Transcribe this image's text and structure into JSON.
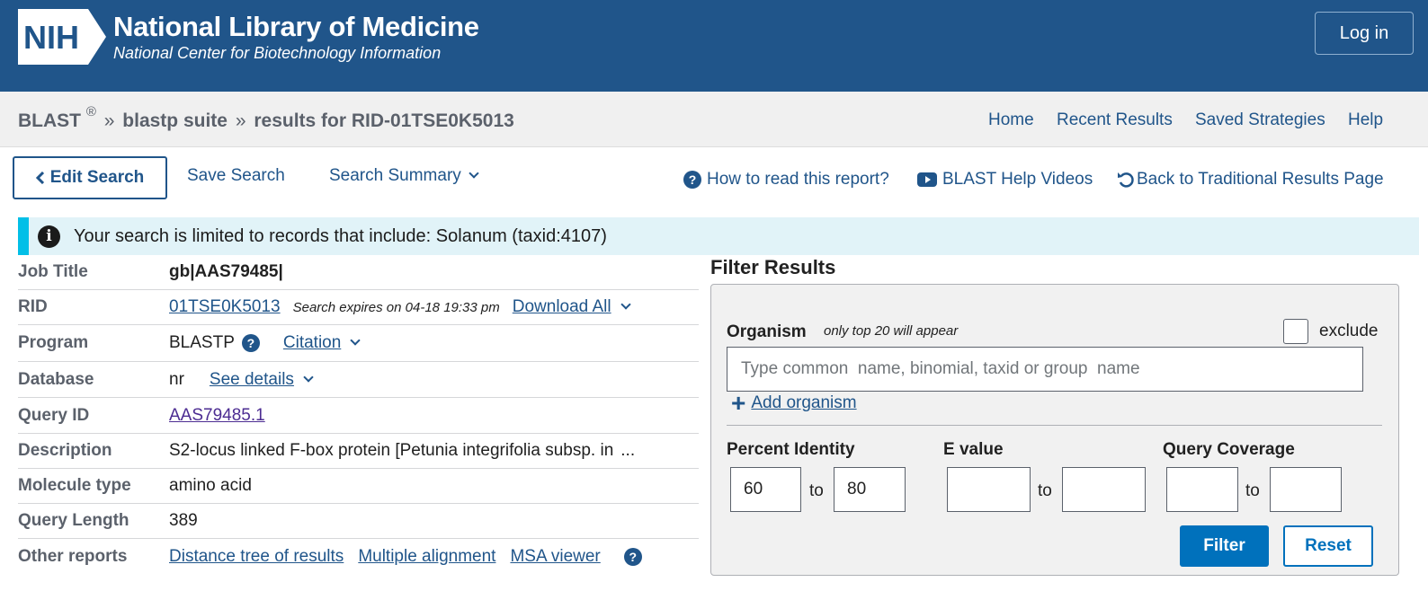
{
  "header": {
    "logo_text": "NIH",
    "title": "National Library of Medicine",
    "subtitle": "National Center for Biotechnology Information",
    "login_label": "Log in"
  },
  "breadcrumb": {
    "root": "BLAST",
    "reg": "®",
    "sep": "»",
    "suite": "blastp suite",
    "current": "results for RID-01TSE0K5013"
  },
  "topnav": [
    "Home",
    "Recent Results",
    "Saved Strategies",
    "Help"
  ],
  "toolbar": {
    "edit_search": "Edit Search",
    "save_search": "Save Search",
    "search_summary": "Search Summary",
    "how_to_read": "How to read this report?",
    "help_videos": "BLAST Help Videos",
    "back_traditional": "Back to Traditional Results Page"
  },
  "banner": {
    "text": "Your search is limited to records that include: Solanum (taxid:4107)"
  },
  "details": {
    "job_title": {
      "label": "Job Title",
      "value": "gb|AAS79485|"
    },
    "rid": {
      "label": "RID",
      "value": "01TSE0K5013",
      "expires": "Search expires on 04-18 19:33 pm",
      "download": "Download All"
    },
    "program": {
      "label": "Program",
      "value": "BLASTP",
      "citation": "Citation"
    },
    "database": {
      "label": "Database",
      "value": "nr",
      "details": "See details"
    },
    "query_id": {
      "label": "Query ID",
      "value": "AAS79485.1"
    },
    "description": {
      "label": "Description",
      "value": "S2-locus linked F-box protein [Petunia integrifolia subsp. in",
      "more": "..."
    },
    "molecule_type": {
      "label": "Molecule type",
      "value": "amino acid"
    },
    "query_length": {
      "label": "Query Length",
      "value": "389"
    },
    "other_reports": {
      "label": "Other reports",
      "links": [
        "Distance tree of results",
        "Multiple alignment",
        "MSA viewer"
      ]
    }
  },
  "filter": {
    "title": "Filter Results",
    "organism_label": "Organism",
    "organism_note": "only top 20 will appear",
    "exclude_label": "exclude",
    "organism_placeholder": "Type common  name, binomial, taxid or group  name",
    "add_organism": "Add organism",
    "percent_identity_label": "Percent Identity",
    "percent_identity_from": "60",
    "percent_identity_to": "80",
    "evalue_label": "E value",
    "evalue_from": "",
    "evalue_to": "",
    "query_coverage_label": "Query Coverage",
    "query_coverage_from": "",
    "query_coverage_to": "",
    "to_label": "to",
    "filter_button": "Filter",
    "reset_button": "Reset"
  },
  "colors": {
    "header_bg": "#20558a",
    "link": "#20558a",
    "banner_bg": "#e1f3f8",
    "banner_accent": "#02bfe7",
    "primary_button": "#0071bc"
  }
}
